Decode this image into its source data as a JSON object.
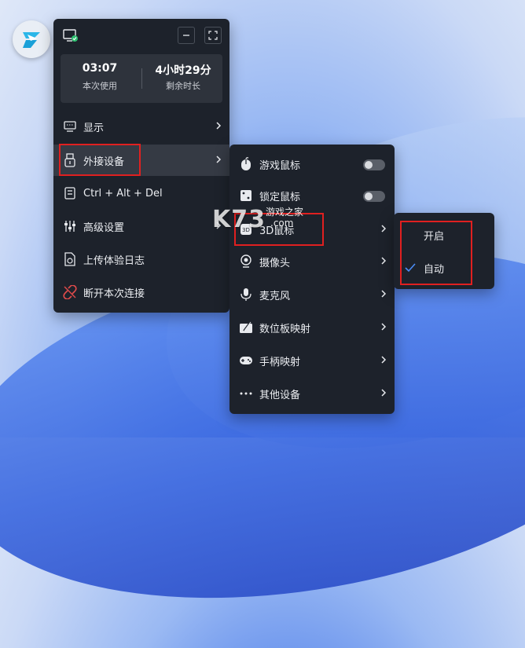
{
  "main_menu": {
    "usage_time": "03:07",
    "usage_label": "本次使用",
    "remaining_time": "4小时29分",
    "remaining_label": "剩余时长",
    "items": [
      {
        "label": "显示",
        "icon": "display-icon"
      },
      {
        "label": "外接设备",
        "icon": "usb-icon"
      },
      {
        "label": "Ctrl + Alt + Del",
        "icon": "ctrl-alt-del-icon"
      },
      {
        "label": "高级设置",
        "icon": "sliders-icon"
      },
      {
        "label": "上传体验日志",
        "icon": "upload-log-icon"
      },
      {
        "label": "断开本次连接",
        "icon": "disconnect-icon"
      }
    ]
  },
  "devices_menu": {
    "items": [
      {
        "label": "游戏鼠标",
        "icon": "game-mouse-icon",
        "toggle": "off"
      },
      {
        "label": "锁定鼠标",
        "icon": "lock-mouse-icon",
        "toggle": "off"
      },
      {
        "label": "3D鼠标",
        "icon": "3d-mouse-icon"
      },
      {
        "label": "摄像头",
        "icon": "camera-icon"
      },
      {
        "label": "麦克风",
        "icon": "microphone-icon"
      },
      {
        "label": "数位板映射",
        "icon": "tablet-icon"
      },
      {
        "label": "手柄映射",
        "icon": "gamepad-icon"
      },
      {
        "label": "其他设备",
        "icon": "more-icon"
      }
    ]
  },
  "mouse_menu": {
    "options": [
      {
        "label": "开启",
        "checked": false
      },
      {
        "label": "自动",
        "checked": true
      }
    ]
  },
  "watermark": {
    "logo": "K73",
    "line1": "游戏之家",
    "line2": ".com"
  },
  "colors": {
    "panel": "#1d222b",
    "highlight": "#e02020",
    "check": "#4a8cf7"
  }
}
